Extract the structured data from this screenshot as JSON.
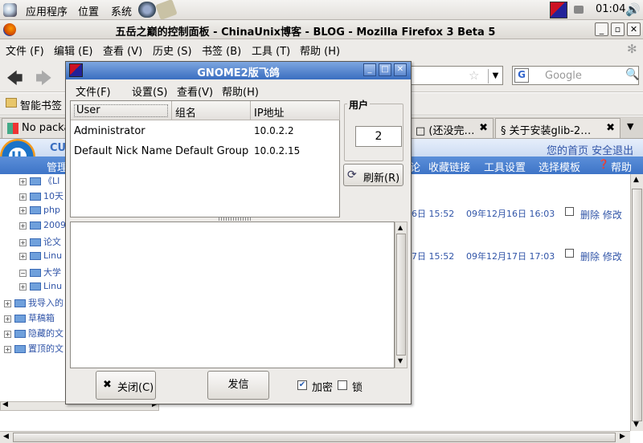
{
  "panel": {
    "menus": [
      "应用程序",
      "位置",
      "系统"
    ],
    "clock": "01:04"
  },
  "firefox": {
    "title": "五岳之巅的控制面板 -  ChinaUnix博客 -  BLOG - Mozilla Firefox 3 Beta 5",
    "menus": [
      "文件 (F)",
      "编辑 (E)",
      "查看 (V)",
      "历史 (S)",
      "书签 (B)",
      "工具 (T)",
      "帮助 (H)"
    ],
    "search_placeholder": "Google",
    "bookmark": "智能书签",
    "tabs": [
      {
        "label": "No packa"
      },
      {
        "label": "□ (还没完…"
      },
      {
        "label": "关于安装glib-2…"
      }
    ]
  },
  "web": {
    "site_logo": "CU",
    "top_right": "您的首页 安全退出",
    "nav_left": "管理",
    "nav_links": [
      "论",
      "收藏链接",
      "工具设置",
      "选择模板",
      "帮助"
    ],
    "tree": [
      {
        "label": "《LI"
      },
      {
        "label": "10天"
      },
      {
        "label": "php"
      },
      {
        "label": "2009"
      },
      {
        "label": "论文"
      },
      {
        "label": "Linu"
      },
      {
        "label": "大学"
      },
      {
        "label": "Linu"
      },
      {
        "label": "我导入的"
      },
      {
        "label": "草稿箱"
      },
      {
        "label": "隐藏的文"
      },
      {
        "label": "置顶的文"
      }
    ],
    "rows": [
      {
        "date1": "6日 15:52",
        "date2": "09年12月16日 16:03",
        "actions": "删除 修改"
      },
      {
        "date1": "7日 15:52",
        "date2": "09年12月17日 17:03",
        "actions": "删除 修改"
      }
    ]
  },
  "dialog": {
    "title": "GNOME2版飞鸽",
    "menus": [
      "文件(F)",
      "设置(S)",
      "查看(V)",
      "帮助(H)"
    ],
    "columns": [
      "User",
      "组名",
      "IP地址"
    ],
    "users": [
      {
        "user": "Administrator",
        "group": "",
        "ip": "10.0.2.2"
      },
      {
        "user": "Default Nick Name",
        "group": "Default Group",
        "ip": "10.0.2.15"
      }
    ],
    "users_label": "用户",
    "user_count": "2",
    "refresh_label": "刷新(R)",
    "close_label": "关闭(C)",
    "send_label": "发信",
    "encrypt_label": "加密",
    "encrypt_checked": true,
    "lock_label": "锁",
    "lock_checked": false
  }
}
